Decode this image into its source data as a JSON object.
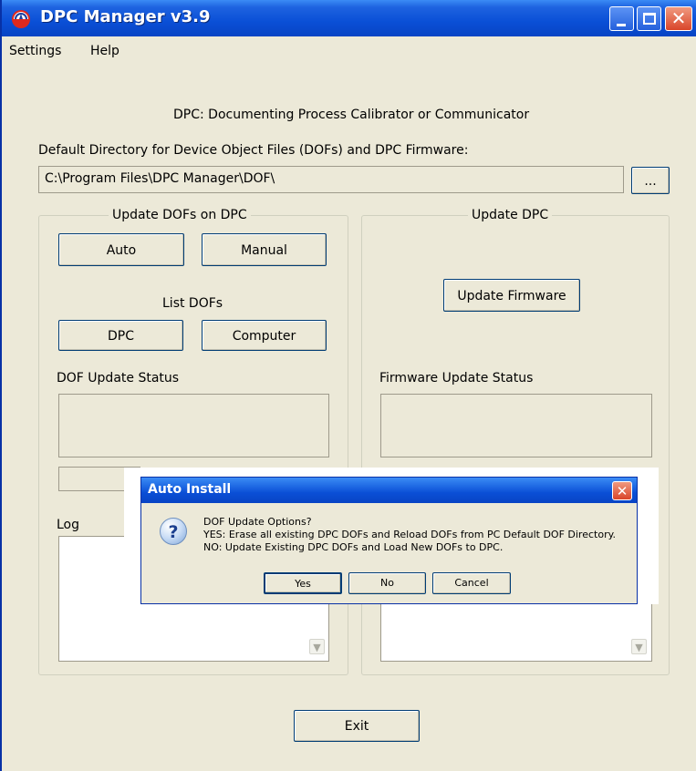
{
  "window": {
    "title": "DPC Manager v3.9",
    "icon": "dpc-app-icon",
    "controls": [
      "minimize-icon",
      "maximize-icon",
      "close-icon"
    ]
  },
  "menu": {
    "settings": "Settings",
    "help": "Help"
  },
  "main": {
    "header": "DPC: Documenting Process Calibrator or Communicator",
    "dir_label": "Default Directory for Device Object Files (DOFs) and DPC Firmware:",
    "dir_value": "C:\\Program Files\\DPC Manager\\DOF\\",
    "browse_label": "...",
    "exit_label": "Exit"
  },
  "update_dofs": {
    "title": "Update DOFs on DPC",
    "auto_label": "Auto",
    "manual_label": "Manual",
    "list_dofs_label": "List DOFs",
    "dpc_label": "DPC",
    "computer_label": "Computer",
    "status_label": "DOF Update Status",
    "log_label": "Log"
  },
  "update_dpc": {
    "title": "Update DPC",
    "firmware_label": "Update Firmware",
    "status_label": "Firmware Update Status"
  },
  "dialog": {
    "title": "Auto Install",
    "icon": "question-icon",
    "line1": "DOF Update Options?",
    "line2": "YES: Erase all existing DPC DOFs and Reload DOFs from PC Default DOF Directory.",
    "line3": "NO: Update Existing DPC DOFs and Load New DOFs to DPC.",
    "yes_label": "Yes",
    "no_label": "No",
    "cancel_label": "Cancel"
  },
  "colors": {
    "titlebar": "#0a4fd6",
    "face": "#ece9d8",
    "close_button": "#d9452a"
  }
}
